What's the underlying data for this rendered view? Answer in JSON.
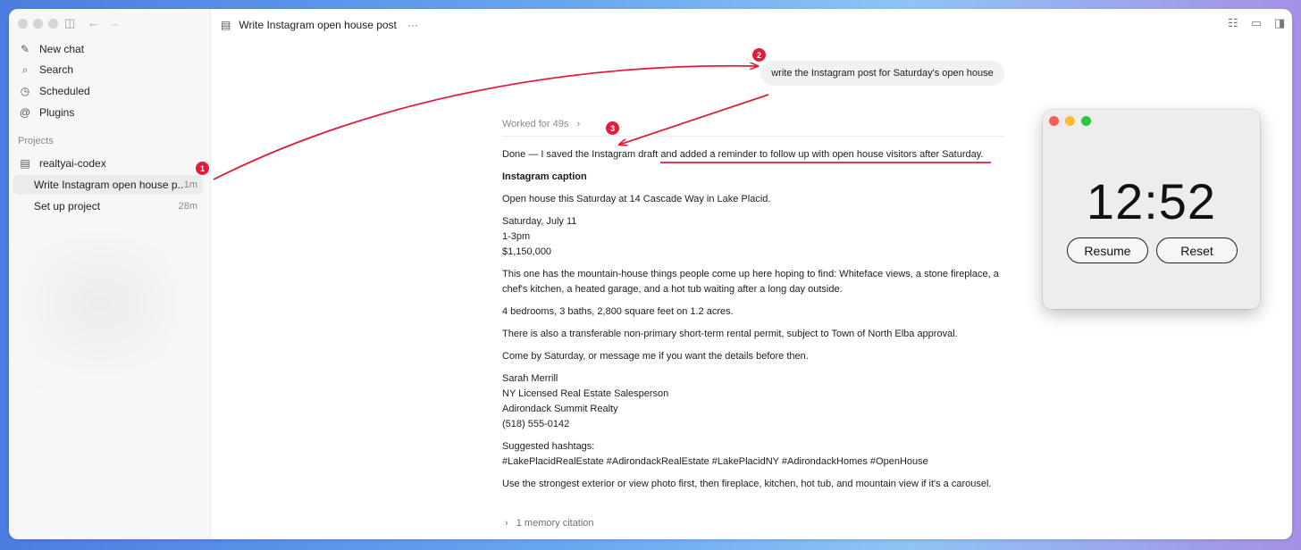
{
  "sidebar": {
    "items": [
      {
        "icon": "edit-icon",
        "label": "New chat"
      },
      {
        "icon": "search-icon",
        "label": "Search"
      },
      {
        "icon": "clock-icon",
        "label": "Scheduled"
      },
      {
        "icon": "at-icon",
        "label": "Plugins"
      }
    ],
    "projects_label": "Projects",
    "project_name": "realtyai-codex",
    "chats": [
      {
        "title": "Write Instagram open house p...",
        "time": "1m"
      },
      {
        "title": "Set up project",
        "time": "28m"
      }
    ]
  },
  "header": {
    "title": "Write Instagram open house post",
    "more": "···"
  },
  "conversation": {
    "user_message": "write the Instagram post for Saturday's open house",
    "worked_for": "Worked for 49s",
    "intro_plain": "Done — I saved the Instagram draft ",
    "intro_underlined": "and added a reminder to follow up with open house visitors after Saturday.",
    "caption_heading": "Instagram caption",
    "p1": "Open house this Saturday at 14 Cascade Way in Lake Placid.",
    "date": "Saturday, July 11",
    "hours": "1-3pm",
    "price": "$1,150,000",
    "p2": "This one has the mountain-house things people come up here hoping to find: Whiteface views, a stone fireplace, a chef's kitchen, a heated garage, and a hot tub waiting after a long day outside.",
    "p3": "4 bedrooms, 3 baths, 2,800 square feet on 1.2 acres.",
    "p4": "There is also a transferable non-primary short-term rental permit, subject to Town of North Elba approval.",
    "p5": "Come by Saturday, or message me if you want the details before then.",
    "sig_name": "Sarah Merrill",
    "sig_title": "NY Licensed Real Estate Salesperson",
    "sig_company": "Adirondack Summit Realty",
    "sig_phone": "(518) 555-0142",
    "hashtags_label": "Suggested hashtags:",
    "hashtags": "#LakePlacidRealEstate #AdirondackRealEstate #LakePlacidNY #AdirondackHomes #OpenHouse",
    "p6": "Use the strongest exterior or view photo first, then fireplace, kitchen, hot tub, and mountain view if it's a carousel.",
    "memory": "1 memory citation"
  },
  "timer": {
    "time": "12:52",
    "resume": "Resume",
    "reset": "Reset"
  },
  "annotations": {
    "badge1": "1",
    "badge2": "2",
    "badge3": "3",
    "color": "#e11d3b"
  }
}
